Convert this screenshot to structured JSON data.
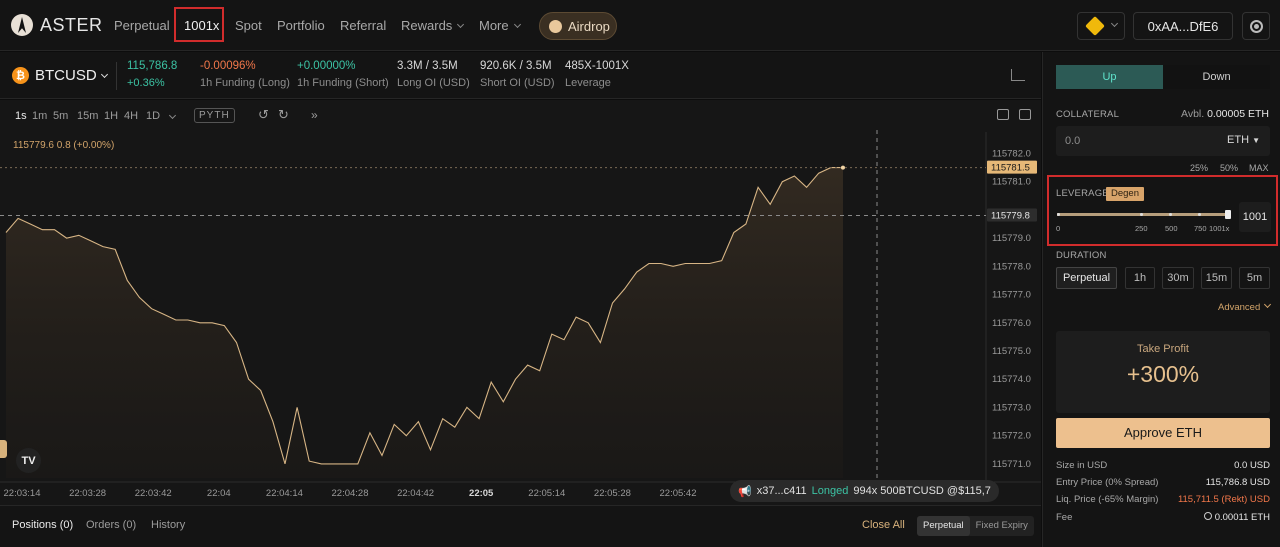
{
  "brand": {
    "name": "ASTER"
  },
  "nav": {
    "items": [
      "Perpetual",
      "Spot",
      "Portfolio",
      "Referral",
      "Rewards",
      "More"
    ],
    "active": "1001x",
    "airdrop": "Airdrop"
  },
  "wallet": {
    "address": "0xAA...DfE6",
    "chain_icon": "bnb-chain-icon"
  },
  "market": {
    "symbol": "BTCUSD",
    "price": "115,786.8",
    "change": "+0.36%",
    "stats": [
      {
        "value": "-0.00096%",
        "label": "1h Funding (Long)"
      },
      {
        "value": "+0.00000%",
        "label": "1h Funding (Short)"
      },
      {
        "value": "3.3M / 3.5M",
        "label": "Long OI (USD)"
      },
      {
        "value": "920.6K / 3.5M",
        "label": "Short OI (USD)"
      },
      {
        "value": "485X-1001X",
        "label": "Leverage"
      }
    ]
  },
  "chart_toolbar": {
    "timeframes": [
      "1s",
      "1m",
      "5m",
      "15m",
      "1H",
      "4H",
      "1D"
    ],
    "active": "1s",
    "pyth": "PYTH"
  },
  "ohlc": "115779.6  0.8 (+0.00%)",
  "chart_data": {
    "type": "area",
    "title": "",
    "xlabel": "",
    "ylabel": "",
    "x_ticks": [
      "22:03:14",
      "22:03:28",
      "22:03:42",
      "22:04",
      "22:04:14",
      "22:04:28",
      "22:04:42",
      "22:05",
      "22:05:14",
      "22:05:28",
      "22:05:42"
    ],
    "y_ticks": [
      "115782.0",
      "115781.0",
      "115779.0",
      "115778.0",
      "115777.0",
      "115776.0",
      "115775.0",
      "115774.0",
      "115773.0",
      "115772.0",
      "115771.0"
    ],
    "ylim": [
      115770.5,
      115782.3
    ],
    "last_price_label": "115781.5",
    "crosshair_label": "115779.8",
    "x_index": [
      0,
      5,
      10,
      15,
      20,
      25,
      30,
      35,
      40,
      45,
      50,
      55,
      60,
      65,
      70,
      75,
      80,
      85,
      90,
      95,
      100,
      105,
      110,
      115,
      120,
      125,
      130,
      135,
      140,
      145,
      150,
      155,
      160,
      165,
      170,
      175,
      180,
      185,
      190,
      195,
      200,
      205,
      210,
      215,
      220,
      225,
      230,
      235,
      240,
      245,
      250,
      255,
      260,
      265,
      270,
      275,
      280,
      285,
      290,
      295,
      300,
      305,
      310,
      315,
      320,
      325,
      330,
      335,
      340,
      345,
      350,
      355,
      360,
      365,
      370,
      375,
      380,
      385
    ],
    "values": [
      115779.2,
      115779.7,
      115779.5,
      115779.3,
      115779.3,
      115779.0,
      115779.1,
      115778.9,
      115778.7,
      115778.6,
      115777.5,
      115776.9,
      115776.5,
      115776.3,
      115776.1,
      115776.1,
      115776.0,
      115776.0,
      115775.9,
      115775.3,
      115774.0,
      115773.6,
      115772.5,
      115771.0,
      115773.0,
      115771.1,
      115771.0,
      115771.0,
      115771.0,
      115771.0,
      115772.1,
      115771.3,
      115772.4,
      115772.0,
      115772.5,
      115771.5,
      115772.6,
      115772.3,
      115773.0,
      115772.6,
      115773.9,
      115773.2,
      115774.0,
      115774.5,
      115774.3,
      115775.6,
      115775.4,
      115776.2,
      115776.0,
      115775.3,
      115776.7,
      115777.2,
      115777.8,
      115778.1,
      115778.1,
      115778.0,
      115778.1,
      115778.1,
      115778.1,
      115778.2,
      115779.2,
      115779.5,
      115780.8,
      115780.2,
      115781.0,
      115781.2,
      115780.8,
      115781.3,
      115781.5,
      115781.5
    ]
  },
  "ticker": {
    "addr": "x37...c411",
    "action": "Longed",
    "detail": "994x 500BTCUSD @$115,7"
  },
  "bottom_tabs": {
    "tabs": [
      "Positions (0)",
      "Orders (0)",
      "History"
    ],
    "close_all": "Close All",
    "segments": [
      "Perpetual",
      "Fixed Expiry"
    ]
  },
  "order_panel": {
    "up": "Up",
    "down": "Down",
    "collateral_label": "COLLATERAL",
    "avbl_label": "Avbl.",
    "avbl_value": "0.00005 ETH",
    "collateral_placeholder": "0.0",
    "collateral_unit": "ETH",
    "pct_buttons": [
      "25%",
      "50%",
      "MAX"
    ],
    "leverage_label": "LEVERAGE",
    "degen": "Degen",
    "leverage_ticks": [
      "0",
      "250",
      "500",
      "750",
      "1001x"
    ],
    "leverage_value": "1001",
    "duration_label": "DURATION",
    "durations": [
      "Perpetual",
      "1h",
      "30m",
      "15m",
      "5m"
    ],
    "advanced": "Advanced",
    "take_profit_label": "Take Profit",
    "take_profit_value": "+300%",
    "approve": "Approve ETH",
    "rows": [
      {
        "label": "Size in USD",
        "value": "0.0 USD"
      },
      {
        "label": "Entry Price (0% Spread)",
        "value": "115,786.8 USD"
      },
      {
        "label": "Liq. Price (-65% Margin)",
        "value": "115,711.5 (Rekt) USD"
      },
      {
        "label": "Fee",
        "value": "0.00011 ETH"
      }
    ]
  }
}
